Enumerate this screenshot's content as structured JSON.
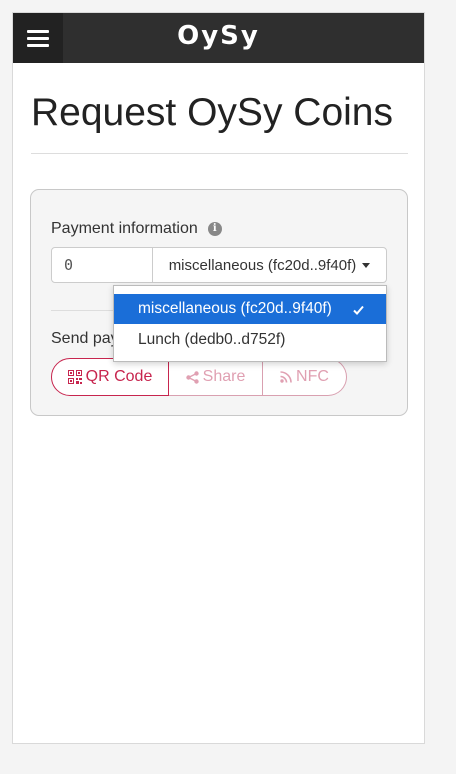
{
  "header": {
    "brand": "OySy",
    "menu_icon": "hamburger-menu-icon"
  },
  "page": {
    "title": "Request OySy Coins"
  },
  "payment": {
    "label": "Payment information",
    "info_icon": "info-icon",
    "amount_value": "0",
    "account_selected": "miscellaneous (fc20d..9f40f)"
  },
  "dropdown": {
    "options": [
      {
        "label": "miscellaneous (fc20d..9f40f)",
        "selected": true
      },
      {
        "label": "Lunch (dedb0..d752f)",
        "selected": false
      }
    ],
    "selected_color": "#1a6ed8"
  },
  "send": {
    "label": "Send pay",
    "buttons": {
      "qr": "QR Code",
      "share": "Share",
      "nfc": "NFC"
    }
  },
  "colors": {
    "accent": "#c7254e",
    "accent_muted": "#e0a0b2",
    "topbar": "#2f2f2f"
  }
}
